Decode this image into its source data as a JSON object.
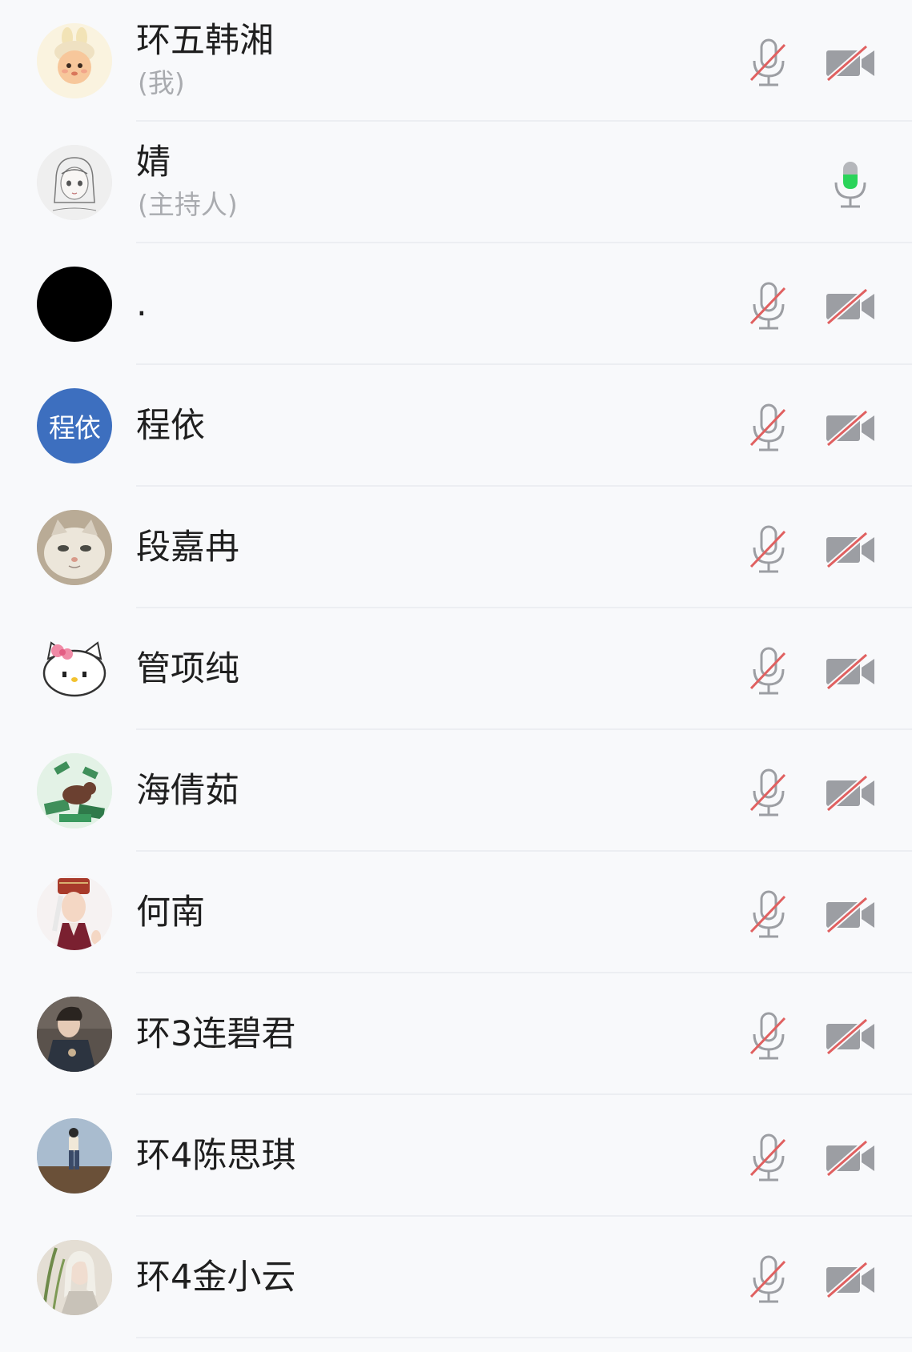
{
  "participants": [
    {
      "name": "环五韩湘",
      "tag": "(我)",
      "mic": "muted",
      "camera": "off",
      "avatar_icon": "cartoon-bunny-avatar",
      "avatar_color": "#f3dca0"
    },
    {
      "name": "婧",
      "tag": "(主持人)",
      "mic": "active",
      "camera": "none",
      "avatar_icon": "sketch-girl-avatar",
      "avatar_color": "#ececec"
    },
    {
      "name": ".",
      "tag": "",
      "mic": "muted",
      "camera": "off",
      "avatar_icon": "black-circle-avatar",
      "avatar_color": "#000000"
    },
    {
      "name": "程依",
      "tag": "",
      "mic": "muted",
      "camera": "off",
      "avatar_icon": "initials-avatar",
      "avatar_text": "程依",
      "avatar_color": "#3d6fbf"
    },
    {
      "name": "段嘉冉",
      "tag": "",
      "mic": "muted",
      "camera": "off",
      "avatar_icon": "cat-photo-avatar",
      "avatar_color": "#c6b9a6"
    },
    {
      "name": "管项纯",
      "tag": "",
      "mic": "muted",
      "camera": "off",
      "avatar_icon": "hello-kitty-avatar",
      "avatar_color": "#ffffff"
    },
    {
      "name": "海倩茹",
      "tag": "",
      "mic": "muted",
      "camera": "off",
      "avatar_icon": "bear-money-avatar",
      "avatar_color": "#dff0e2"
    },
    {
      "name": "何南",
      "tag": "",
      "mic": "muted",
      "camera": "off",
      "avatar_icon": "illustrated-man-avatar",
      "avatar_color": "#f4eeee"
    },
    {
      "name": "环3连碧君",
      "tag": "",
      "mic": "muted",
      "camera": "off",
      "avatar_icon": "person-photo-avatar",
      "avatar_color": "#4a4440"
    },
    {
      "name": "环4陈思琪",
      "tag": "",
      "mic": "muted",
      "camera": "off",
      "avatar_icon": "landscape-figure-avatar",
      "avatar_color": "#9fb3c8"
    },
    {
      "name": "环4金小云",
      "tag": "",
      "mic": "muted",
      "camera": "off",
      "avatar_icon": "girl-photo-avatar",
      "avatar_color": "#d9d2c8"
    }
  ],
  "colors": {
    "muted_red": "#e06060",
    "icon_gray": "#9c9ea3",
    "active_green": "#2bd45a",
    "background": "#f8f9fb"
  }
}
